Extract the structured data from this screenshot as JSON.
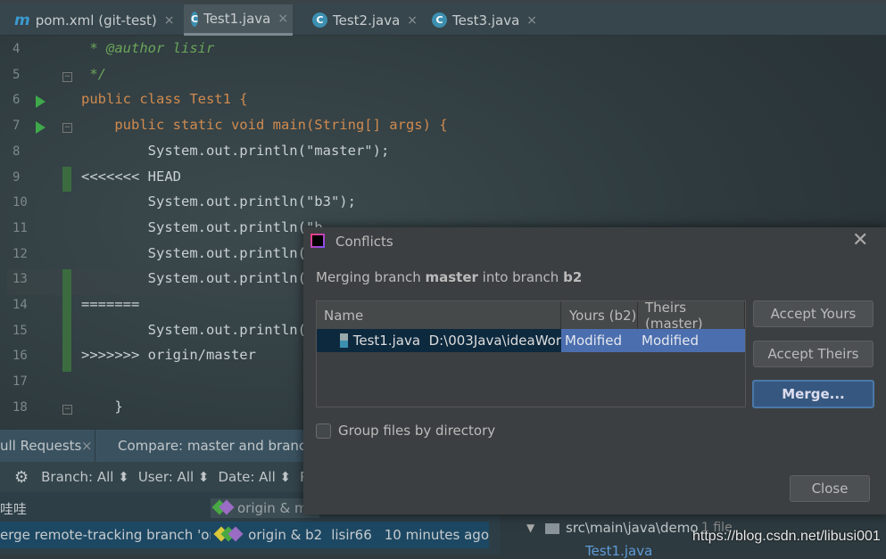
{
  "tabs": [
    {
      "label": "pom.xml (git-test)",
      "icon": "maven-icon",
      "icon_glyph": "m"
    },
    {
      "label": "Test1.java",
      "icon": "java-class-icon",
      "icon_glyph": "C",
      "active": true
    },
    {
      "label": "Test2.java",
      "icon": "java-class-icon",
      "icon_glyph": "C"
    },
    {
      "label": "Test3.java",
      "icon": "java-class-icon",
      "icon_glyph": "C"
    }
  ],
  "close_glyph": "×",
  "editor": {
    "lines": [
      {
        "n": "4",
        "text": " * @author lisir"
      },
      {
        "n": "5",
        "text": " */"
      },
      {
        "n": "6",
        "text": "public class Test1 {"
      },
      {
        "n": "7",
        "text": "    public static void main(String[] args) {"
      },
      {
        "n": "8",
        "text": "        System.out.println(\"master\");"
      },
      {
        "n": "9",
        "text": "<<<<<<< HEAD"
      },
      {
        "n": "10",
        "text": "        System.out.println(\"b3\");"
      },
      {
        "n": "11",
        "text": "        System.out.println(\"b"
      },
      {
        "n": "12",
        "text": "        System.out.println("
      },
      {
        "n": "13",
        "text": "        System.out.println("
      },
      {
        "n": "14",
        "text": "======="
      },
      {
        "n": "15",
        "text": "        System.out.println("
      },
      {
        "n": "16",
        "text": ">>>>>>> origin/master"
      },
      {
        "n": "17",
        "text": ""
      },
      {
        "n": "18",
        "text": "    }"
      }
    ]
  },
  "bottom": {
    "tabs": [
      {
        "label": "ull Requests"
      },
      {
        "label": "Compare: master and branch"
      }
    ],
    "filters": [
      "Branch: All",
      "User: All",
      "Date: All",
      "Pa"
    ],
    "commits": [
      {
        "message": "哇哇",
        "refs": "origin & ma"
      },
      {
        "message": "erge remote-tracking branch 'origin",
        "refs": "origin & b2",
        "author": "lisir66",
        "date": "10 minutes ago",
        "selected": true
      }
    ]
  },
  "changes_tree": {
    "folder": "src\\main\\java\\demo",
    "count": "1 file",
    "file": "Test1.java"
  },
  "dialog": {
    "title": "Conflicts",
    "message_parts": [
      "Merging branch ",
      "master",
      " into branch ",
      "b2"
    ],
    "columns": [
      "Name",
      "Yours (b2)",
      "Theirs (master)"
    ],
    "rows": [
      {
        "name": "Test1.java",
        "path": "D:\\003Java\\ideaWor",
        "yours": "Modified",
        "theirs": "Modified"
      }
    ],
    "buttons": {
      "accept_yours": "Accept Yours",
      "accept_theirs": "Accept Theirs",
      "merge": "Merge...",
      "close": "Close"
    },
    "group_checkbox": {
      "label": "Group files by directory",
      "checked": false
    }
  },
  "watermark": "https://blog.csdn.net/libusi001",
  "colors": {
    "accent": "#365880",
    "selection": "#4b6eaf",
    "keyword": "#cc7832",
    "comment": "#6aa55a"
  }
}
